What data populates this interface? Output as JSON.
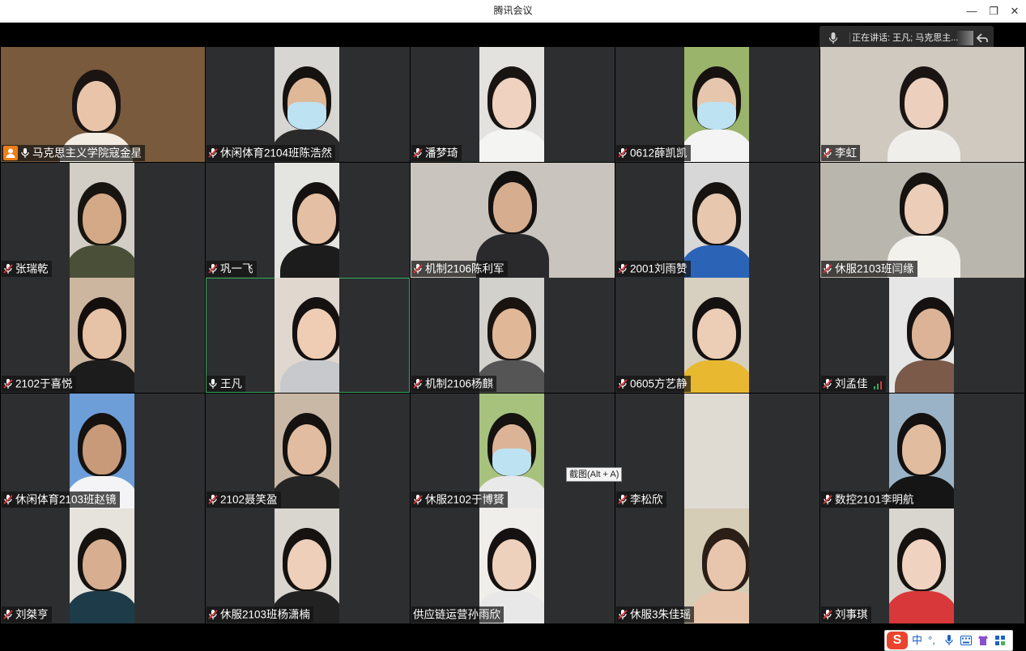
{
  "window": {
    "title": "腾讯会议",
    "minimize_glyph": "—",
    "maximize_glyph": "❐",
    "close_glyph": "✕"
  },
  "speaking_bar": {
    "text": "正在讲话: 王凡; 马克思主..."
  },
  "tooltip": {
    "text": "截图(Alt + A)"
  },
  "participants": [
    {
      "name": "马克思主义学院寇金星",
      "host": true,
      "mic": "on"
    },
    {
      "name": "休闲体育2104班陈浩然",
      "mic": "off"
    },
    {
      "name": "潘梦琦",
      "mic": "off"
    },
    {
      "name": "0612薛凯凯",
      "mic": "off"
    },
    {
      "name": "李虹",
      "mic": "off"
    },
    {
      "name": "张瑞乾",
      "mic": "off"
    },
    {
      "name": "巩一飞",
      "mic": "off"
    },
    {
      "name": "机制2106陈利军",
      "mic": "off"
    },
    {
      "name": "2001刘雨赞",
      "mic": "off"
    },
    {
      "name": "休服2103班闫缘",
      "mic": "off"
    },
    {
      "name": "2102于喜悦",
      "mic": "off"
    },
    {
      "name": "王凡",
      "mic": "on",
      "active": true
    },
    {
      "name": "机制2106杨麒",
      "mic": "off"
    },
    {
      "name": "0605方艺静",
      "mic": "off"
    },
    {
      "name": "刘孟佳",
      "mic": "off",
      "signal": true
    },
    {
      "name": "休闲体育2103班赵镜",
      "mic": "off"
    },
    {
      "name": "2102聂笑盈",
      "mic": "off"
    },
    {
      "name": "休服2102于博贇",
      "mic": "off"
    },
    {
      "name": "李松欣",
      "mic": "off"
    },
    {
      "name": "数控2101李明航",
      "mic": "off"
    },
    {
      "name": "刘桀亨",
      "mic": "off"
    },
    {
      "name": "休服2103班杨潇楠",
      "mic": "off"
    },
    {
      "name": "供应链运营孙雨欣",
      "mic": "none"
    },
    {
      "name": "休服3朱佳瑶",
      "mic": "off"
    },
    {
      "name": "刘事琪",
      "mic": "off"
    }
  ],
  "ime": {
    "logo": "S",
    "mode": "中",
    "punct": "°,",
    "icons": [
      "mic-icon",
      "keyboard-icon",
      "skin-icon",
      "grid-icon"
    ]
  },
  "colors": {
    "tile_bg": "#2d2e30",
    "active_border": "#2fae5a",
    "host_badge": "#f07e16",
    "mic_off_red": "#e0343a"
  }
}
